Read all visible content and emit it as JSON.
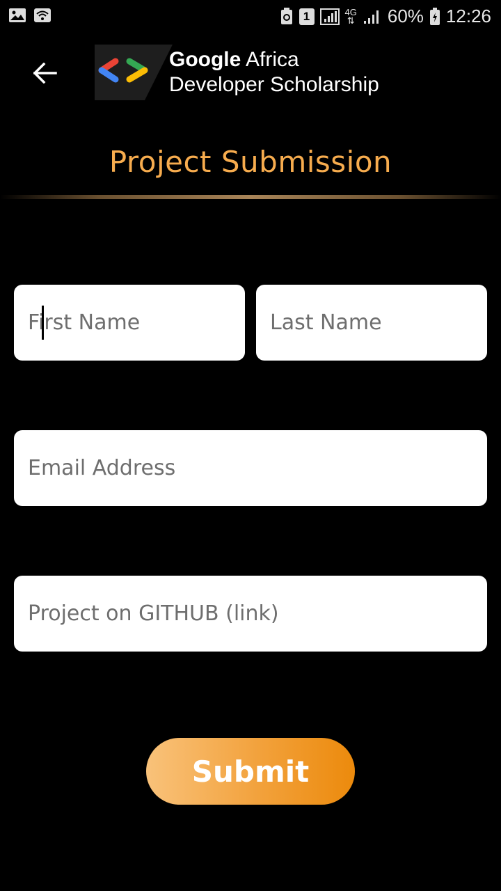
{
  "status_bar": {
    "sim_badge": "1",
    "network": "4G",
    "battery": "60%",
    "time": "12:26"
  },
  "header": {
    "brand_line1_bold": "Google",
    "brand_line1_rest": " Africa",
    "brand_line2": "Developer Scholarship"
  },
  "page": {
    "title": "Project Submission"
  },
  "form": {
    "first_name": {
      "value": "",
      "placeholder": "First Name"
    },
    "last_name": {
      "value": "",
      "placeholder": "Last Name"
    },
    "email": {
      "value": "",
      "placeholder": "Email Address"
    },
    "github": {
      "value": "",
      "placeholder": "Project on GITHUB (link)"
    },
    "submit_label": "Submit"
  },
  "colors": {
    "background": "#000000",
    "accent": "#f7ac4e",
    "button_start": "#f9c27a",
    "button_end": "#ec8a0c",
    "field_bg": "#ffffff"
  },
  "icons": [
    "image-icon",
    "wifi-icon",
    "sync-icon",
    "signal-icon",
    "battery-icon",
    "back-arrow-icon",
    "developers-logo-icon"
  ]
}
